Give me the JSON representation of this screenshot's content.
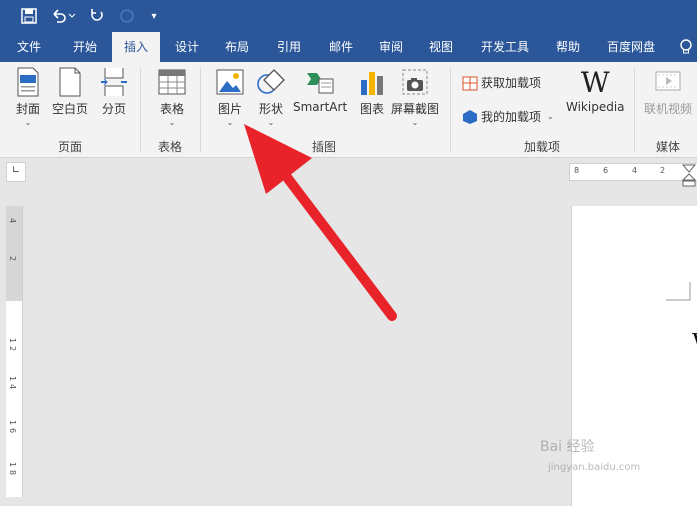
{
  "qat": {
    "more_glyph": "▾"
  },
  "tabs": [
    {
      "label": "文件"
    },
    {
      "label": "开始"
    },
    {
      "label": "插入",
      "active": true
    },
    {
      "label": "设计"
    },
    {
      "label": "布局"
    },
    {
      "label": "引用"
    },
    {
      "label": "邮件"
    },
    {
      "label": "审阅"
    },
    {
      "label": "视图"
    },
    {
      "label": "开发工具"
    },
    {
      "label": "帮助"
    },
    {
      "label": "百度网盘"
    }
  ],
  "ribbon": {
    "pages": {
      "cover": "封面",
      "blank": "空白页",
      "break": "分页",
      "group": "页面"
    },
    "table": {
      "label": "表格",
      "group": "表格"
    },
    "illus": {
      "picture": "图片",
      "shapes": "形状",
      "smartart": "SmartArt",
      "chart": "图表",
      "screenshot": "屏幕截图",
      "group": "插图"
    },
    "addins": {
      "get": "获取加载项",
      "my": "我的加载项",
      "wiki": "Wikipedia",
      "group": "加载项"
    },
    "media": {
      "video": "联机视频",
      "group": "媒体"
    }
  },
  "ruler": {
    "h_ticks": [
      "8",
      "6",
      "4",
      "2"
    ],
    "v_ticks": [
      "4",
      "2",
      "1",
      "2",
      "1",
      "4",
      "1",
      "6",
      "1",
      "8"
    ]
  },
  "watermark": {
    "line1": "Bai 经验",
    "line2": "jingyan.baidu.com"
  },
  "colors": {
    "brand": "#2b579a",
    "arrow": "#e8232a"
  }
}
